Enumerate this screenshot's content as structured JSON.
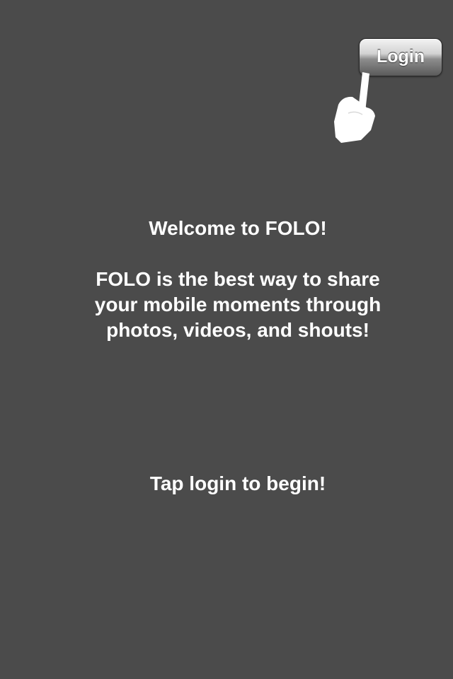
{
  "header": {
    "login_label": "Login"
  },
  "main": {
    "welcome": "Welcome to FOLO!",
    "description_lines": [
      "FOLO is the best way to share",
      "your mobile moments through",
      "photos, videos, and shouts!"
    ],
    "tap_hint": "Tap login to begin!"
  },
  "icons": {
    "pointer": "pointing-hand-icon"
  },
  "colors": {
    "background": "#4b4b4b",
    "text": "#ffffff"
  }
}
